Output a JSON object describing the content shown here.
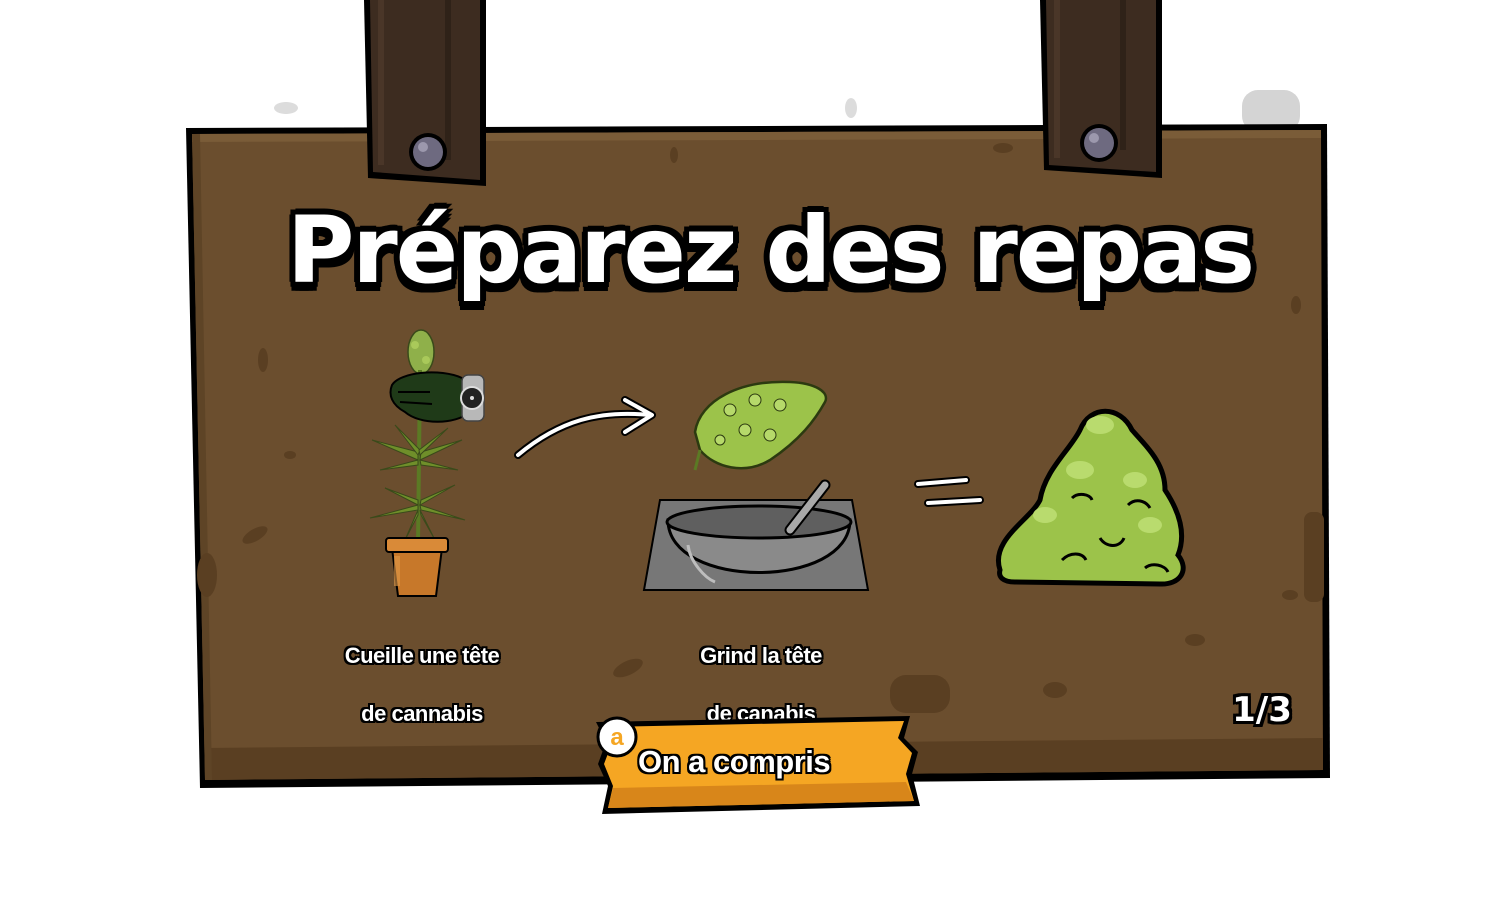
{
  "tutorial": {
    "title": "Préparez des repas",
    "steps": [
      {
        "caption_line1": "Cueille une tête",
        "caption_line2": "de cannabis"
      },
      {
        "caption_line1": "Grind la tête",
        "caption_line2": "de canabis"
      }
    ],
    "page_indicator": "1/3"
  },
  "confirm_button": {
    "label": "On a compris",
    "key_hint": "a"
  },
  "colors": {
    "board": "#6b4e2e",
    "board_dark": "#5a3f22",
    "post": "#3d2c20",
    "button": "#f5a623",
    "weed_green": "#9cc34a",
    "pot": "#c7782a",
    "bowl": "#8a8a8a"
  },
  "icons": {
    "hand": "gloved-hand-icon",
    "watch": "wristwatch-icon",
    "arrow": "curved-arrow-icon",
    "equals": "equals-sign-icon",
    "key": "a-key-icon"
  }
}
